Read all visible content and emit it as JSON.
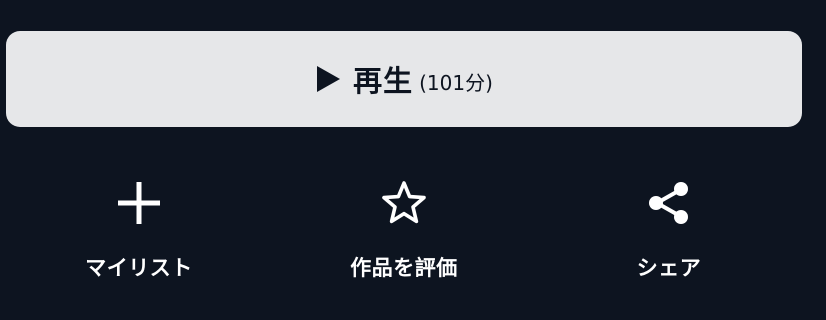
{
  "play": {
    "label": "再生",
    "duration": "(101分)",
    "icon": "play-icon"
  },
  "actions": [
    {
      "label": "マイリスト",
      "icon": "plus-icon"
    },
    {
      "label": "作品を評価",
      "icon": "star-icon"
    },
    {
      "label": "シェア",
      "icon": "share-icon"
    }
  ],
  "colors": {
    "background": "#0d1420",
    "button_bg": "#e6e7e9",
    "text_light": "#ffffff",
    "text_dark": "#0d1420"
  }
}
